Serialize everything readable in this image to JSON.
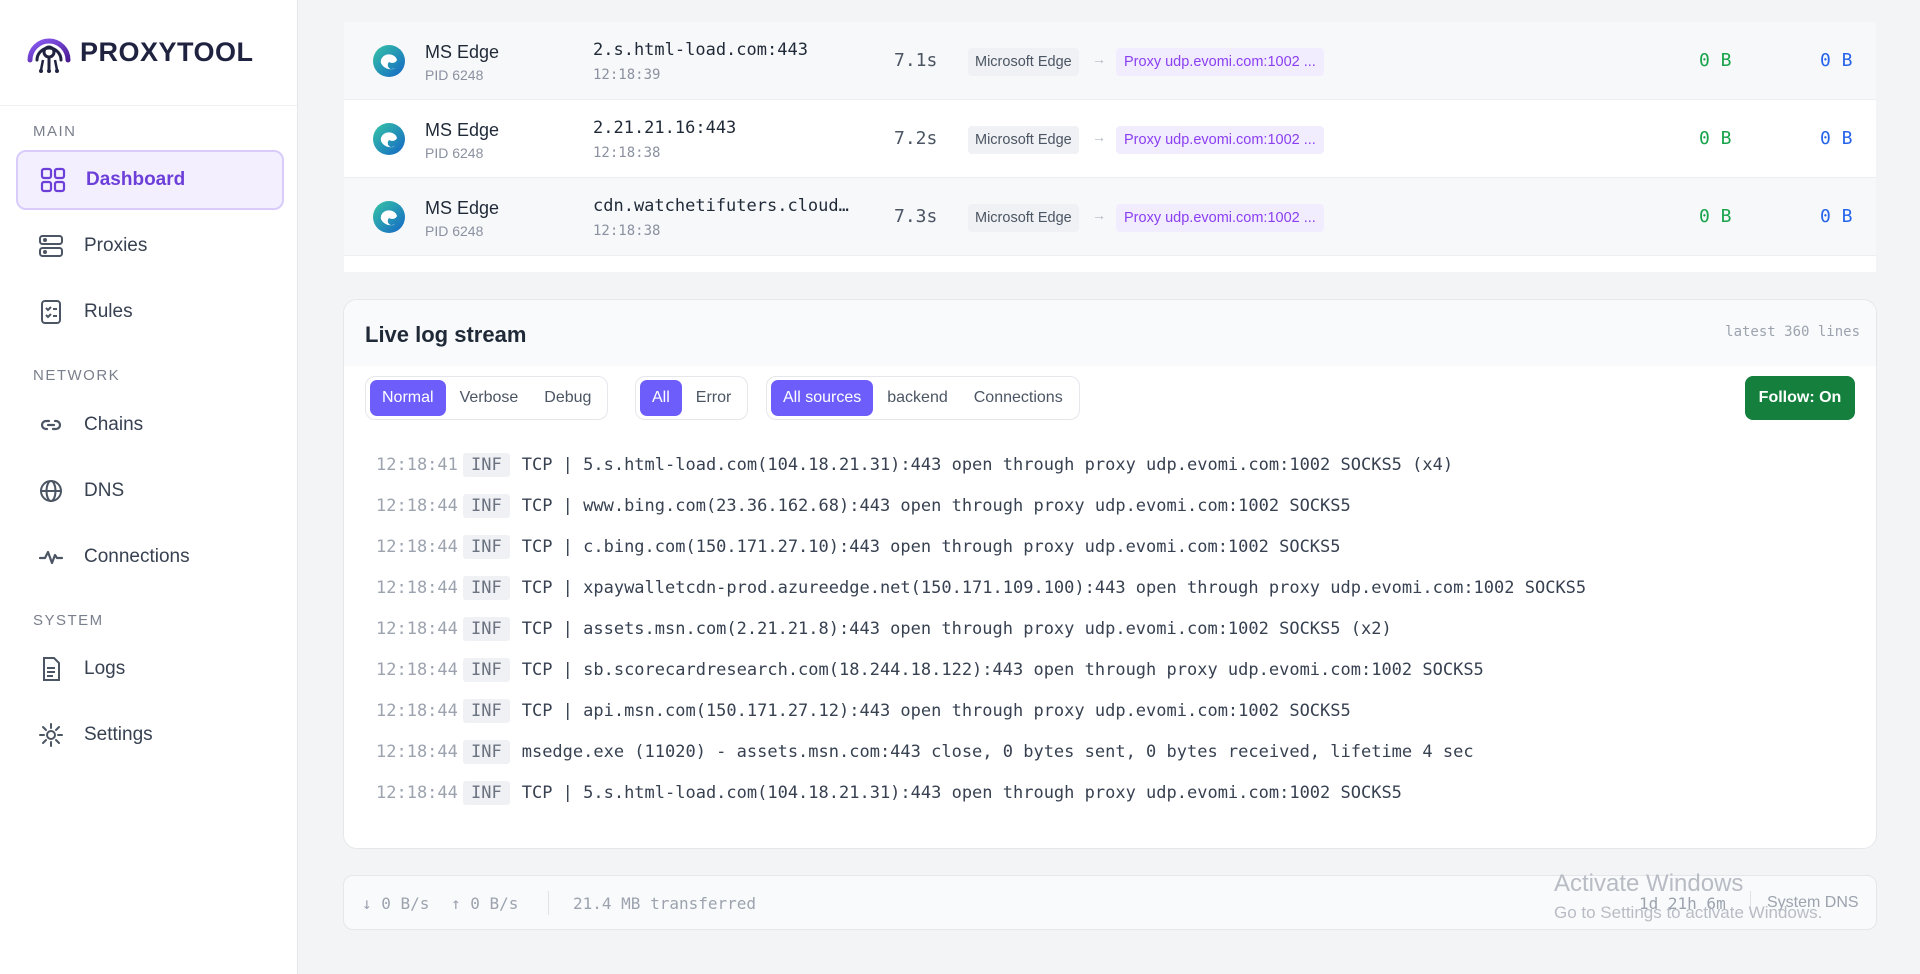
{
  "brand": {
    "name": "PROXYTOOL"
  },
  "sidebar": {
    "sections": [
      "MAIN",
      "NETWORK",
      "SYSTEM"
    ],
    "items": [
      {
        "label": "Dashboard",
        "icon": "grid-icon"
      },
      {
        "label": "Proxies",
        "icon": "server-icon"
      },
      {
        "label": "Rules",
        "icon": "checklist-icon"
      },
      {
        "label": "Chains",
        "icon": "link-icon"
      },
      {
        "label": "DNS",
        "icon": "globe-icon"
      },
      {
        "label": "Connections",
        "icon": "activity-icon"
      },
      {
        "label": "Logs",
        "icon": "file-icon"
      },
      {
        "label": "Settings",
        "icon": "sun-icon"
      }
    ],
    "active": "Dashboard"
  },
  "connections": [
    {
      "app": "MS Edge",
      "pid": "PID 6248",
      "host": "2.s.html-load.com:443",
      "time": "12:18:39",
      "duration": "7.1s",
      "from": "Microsoft Edge",
      "to": "Proxy udp.evomi.com:1002 ...",
      "bytes_in": "0 B",
      "bytes_out": "0 B"
    },
    {
      "app": "MS Edge",
      "pid": "PID 6248",
      "host": "2.21.21.16:443",
      "time": "12:18:38",
      "duration": "7.2s",
      "from": "Microsoft Edge",
      "to": "Proxy udp.evomi.com:1002 ...",
      "bytes_in": "0 B",
      "bytes_out": "0 B"
    },
    {
      "app": "MS Edge",
      "pid": "PID 6248",
      "host": "cdn.watchetifuters.cloud…",
      "time": "12:18:38",
      "duration": "7.3s",
      "from": "Microsoft Edge",
      "to": "Proxy udp.evomi.com:1002 ...",
      "bytes_in": "0 B",
      "bytes_out": "0 B"
    }
  ],
  "chain_arrow": "→",
  "log": {
    "title": "Live log stream",
    "lines_label": "latest 360 lines",
    "levels": [
      "Normal",
      "Verbose",
      "Debug"
    ],
    "active_level": "Normal",
    "filters": [
      "All",
      "Error"
    ],
    "active_filter": "All",
    "sources": [
      "All sources",
      "backend",
      "Connections"
    ],
    "active_source": "All sources",
    "follow_label": "Follow: On",
    "entries": [
      {
        "t": "12:18:41",
        "lv": "INF",
        "msg": "TCP | 5.s.html-load.com(104.18.21.31):443 open through proxy udp.evomi.com:1002 SOCKS5 (x4)"
      },
      {
        "t": "12:18:44",
        "lv": "INF",
        "msg": "TCP | www.bing.com(23.36.162.68):443 open through proxy udp.evomi.com:1002 SOCKS5"
      },
      {
        "t": "12:18:44",
        "lv": "INF",
        "msg": "TCP | c.bing.com(150.171.27.10):443 open through proxy udp.evomi.com:1002 SOCKS5"
      },
      {
        "t": "12:18:44",
        "lv": "INF",
        "msg": "TCP | xpaywalletcdn-prod.azureedge.net(150.171.109.100):443 open through proxy udp.evomi.com:1002 SOCKS5"
      },
      {
        "t": "12:18:44",
        "lv": "INF",
        "msg": "TCP | assets.msn.com(2.21.21.8):443 open through proxy udp.evomi.com:1002 SOCKS5 (x2)"
      },
      {
        "t": "12:18:44",
        "lv": "INF",
        "msg": "TCP | sb.scorecardresearch.com(18.244.18.122):443 open through proxy udp.evomi.com:1002 SOCKS5"
      },
      {
        "t": "12:18:44",
        "lv": "INF",
        "msg": "TCP | api.msn.com(150.171.27.12):443 open through proxy udp.evomi.com:1002 SOCKS5"
      },
      {
        "t": "12:18:44",
        "lv": "INF",
        "msg": "msedge.exe (11020) - assets.msn.com:443 close, 0 bytes sent, 0 bytes received, lifetime 4 sec"
      },
      {
        "t": "12:18:44",
        "lv": "INF",
        "msg": "TCP | 5.s.html-load.com(104.18.21.31):443 open through proxy udp.evomi.com:1002 SOCKS5"
      }
    ]
  },
  "status": {
    "down": "↓ 0 B/s",
    "up": "↑ 0 B/s",
    "transferred": "21.4 MB transferred",
    "uptime": "1d 21h 6m",
    "dns": "System DNS"
  },
  "watermark": {
    "line1": "Activate Windows",
    "line2": "Go to Settings to activate Windows."
  },
  "colors": {
    "accent": "#6d5efc",
    "brand_purple": "#6d3fd9",
    "follow_green": "#15803d",
    "bytes_in": "#16a34a",
    "bytes_out": "#2563eb"
  }
}
